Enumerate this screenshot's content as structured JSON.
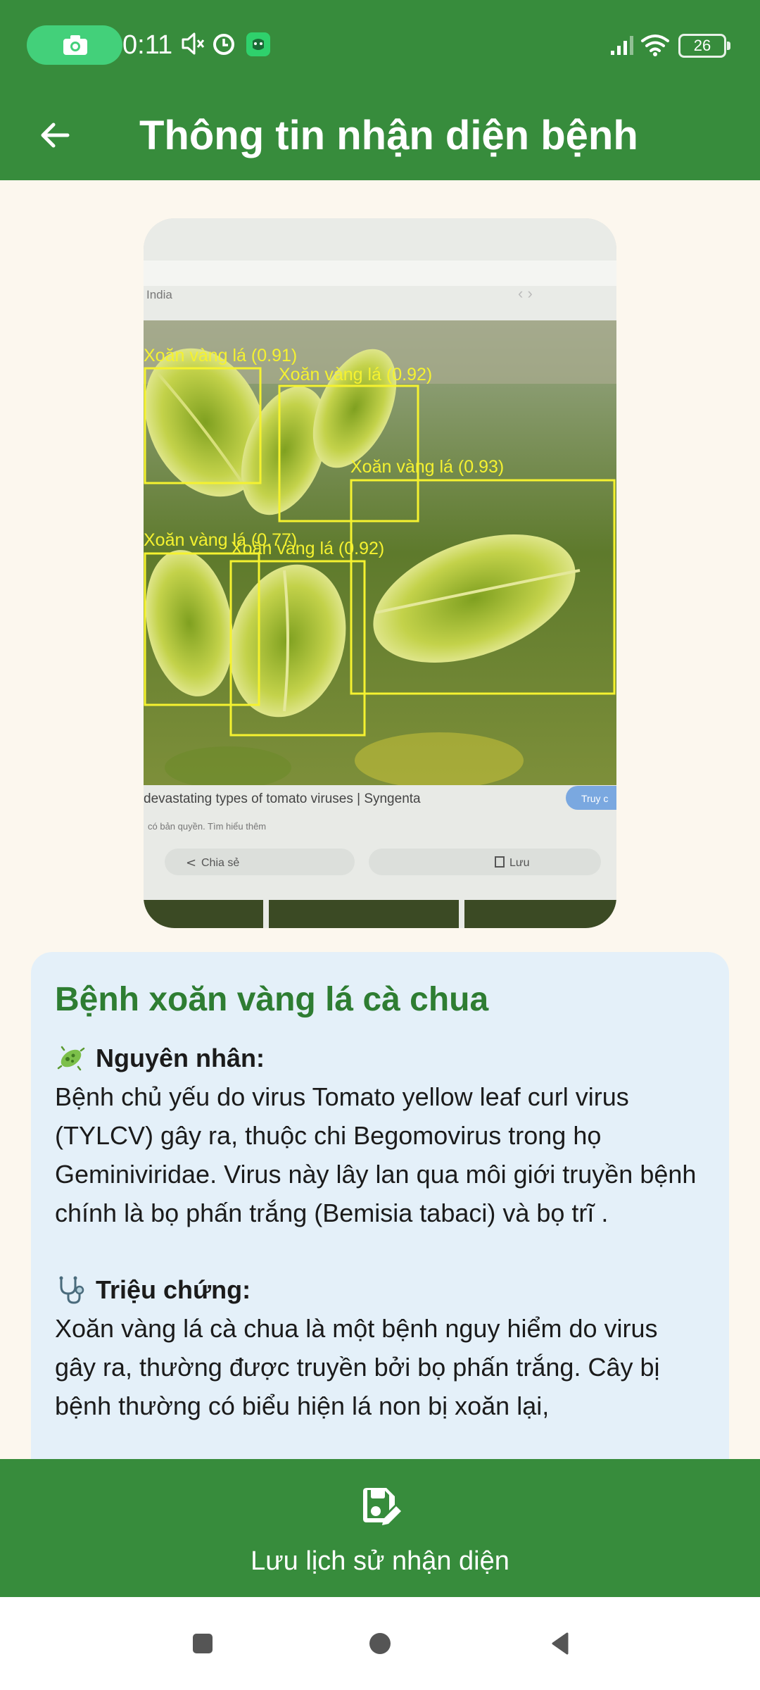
{
  "status_bar": {
    "time": "0:11",
    "battery_level": "26",
    "icons": [
      "screen-record-icon",
      "mute-icon",
      "alarm-icon",
      "app-notification-icon",
      "signal-icon",
      "wifi-icon",
      "battery-icon"
    ]
  },
  "app_bar": {
    "title": "Thông tin nhận diện bệnh",
    "back_icon": "arrow-left-icon"
  },
  "detections": [
    {
      "label": "Xoăn vàng lá (0.91)"
    },
    {
      "label": "Xoăn vàng lá (0.92)"
    },
    {
      "label": "Xoăn vàng lá (0.93)"
    },
    {
      "label": "Xoăn vàng lá (0.77)"
    },
    {
      "label": "Xoăn vàng lá (0.92)"
    }
  ],
  "photo_texts": {
    "browser_tab": "India",
    "page_caption": "devastating types of tomato viruses | Syngenta",
    "copyright_note": "có bản quyền. Tìm hiểu thêm",
    "share_label": "Chia sẻ",
    "save_label": "Lưu",
    "visit_label": "Truy c"
  },
  "info_card": {
    "disease_name": "Bệnh xoăn vàng lá cà chua",
    "cause": {
      "icon": "microbe-icon",
      "heading": "Nguyên nhân:",
      "text": "Bệnh chủ yếu do virus Tomato yellow leaf curl virus (TYLCV) gây ra, thuộc chi Begomovirus trong họ Geminiviridae. Virus này lây lan qua môi giới truyền bệnh chính là bọ phấn trắng (Bemisia tabaci) và bọ trĩ ."
    },
    "symptoms": {
      "icon": "stethoscope-icon",
      "heading": "Triệu chứng:",
      "text": "Xoăn vàng lá cà chua là một bệnh nguy hiểm do virus gây ra, thường được truyền bởi bọ phấn trắng. Cây bị bệnh thường có biểu hiện lá non bị xoăn lại,"
    }
  },
  "save_bar": {
    "icon": "save-edit-icon",
    "label": "Lưu lịch sử nhận diện"
  },
  "colors": {
    "primary_green": "#378c3c",
    "title_green": "#2e7d32",
    "card_background": "#e4f0f9",
    "page_background": "#fcf7ee",
    "bbox_yellow": "#f5f230"
  }
}
